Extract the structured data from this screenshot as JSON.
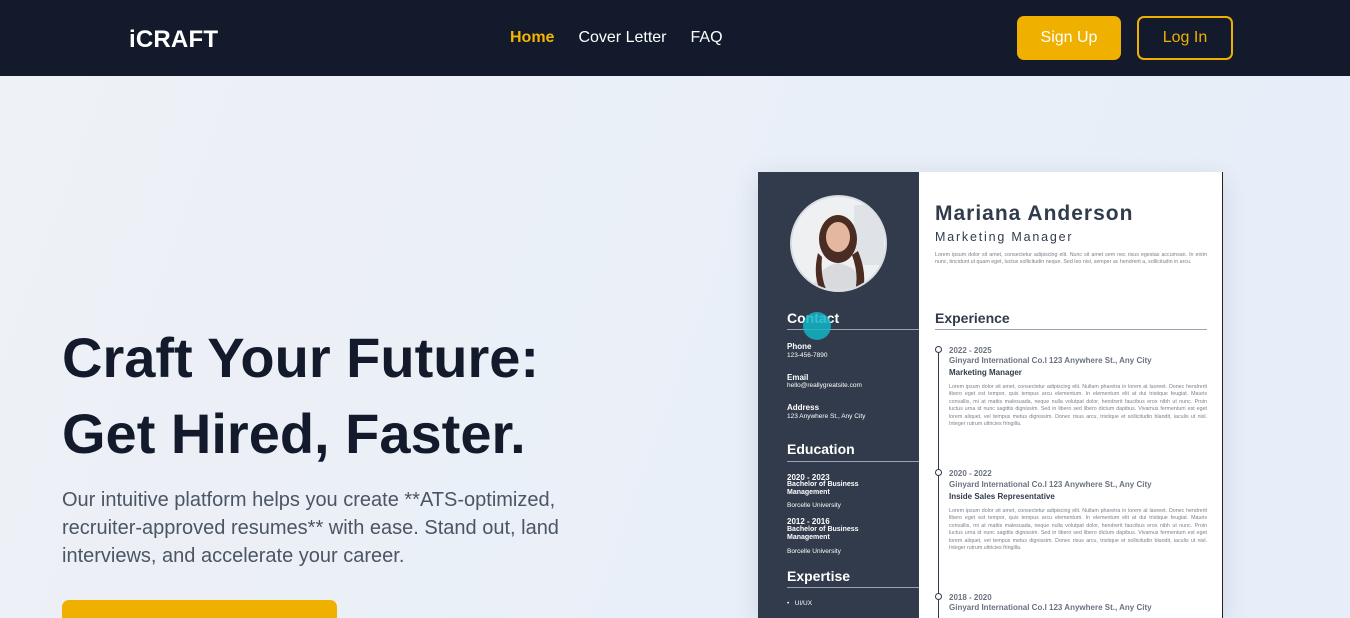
{
  "nav": {
    "brand": "iCRAFT",
    "links": [
      "Home",
      "Cover Letter",
      "FAQ"
    ],
    "signup": "Sign Up",
    "login": "Log In",
    "accent_color": "#f0b000",
    "bg_color": "#121a2c"
  },
  "hero": {
    "headline_line1": "Craft Your Future:",
    "headline_line2": "Get Hired, Faster.",
    "subtext": "Our intuitive platform helps you create **ATS-optimized, recruiter-approved resumes** with ease. Stand out, land interviews, and accelerate your career.",
    "cta_label": ""
  },
  "resume": {
    "name": "Mariana Anderson",
    "role": "Marketing Manager",
    "intro": "Lorem ipsum dolor sit amet, consectetur adipiscing elit. Nunc sit amet sem nec risus egestas accumsan. In enim nunc, tincidunt ut quam eget, luctus sollicitudin neque. Sed leo nisl, semper ac hendrerit a, sollicitudin in arcu.",
    "contact": {
      "heading": "Contact",
      "phone_label": "Phone",
      "phone": "123-456-7890",
      "email_label": "Email",
      "email": "hello@reallygreatsite.com",
      "address_label": "Address",
      "address": "123 Anywhere St., Any City"
    },
    "education": {
      "heading": "Education",
      "items": [
        {
          "period": "2020 - 2023",
          "degree_1": "Bachelor of Business",
          "degree_2": "Management",
          "school": "Borcelle University"
        },
        {
          "period": "2012 - 2016",
          "degree_1": "Bachelor of Business",
          "degree_2": "Management",
          "school": "Borcelle University"
        }
      ]
    },
    "expertise": {
      "heading": "Expertise",
      "items": [
        "UI/UX"
      ]
    },
    "experience": {
      "heading": "Experience",
      "jobs": [
        {
          "period": "2022 - 2025",
          "company": "Ginyard International Co.l 123 Anywhere St., Any City",
          "title": "Marketing Manager",
          "desc": "Lorem ipsum dolor sit amet, consectetur adipiscing elit. Nullam pharetra in lorem at laoreet. Donec hendrerit libero eget est tempor, quis tempus arcu elementum. In elementum elit at dui tristique feugiat. Mauris convallis, mi at mattis malesuada, neque nulla volutpat dolor, hendrerit faucibus eros nibh ut nunc. Proin luctus urna id nunc sagittis dignissim. Sed in libero sed libero dictum dapibus. Vivamus fermentum est eget lorem aliquet, vel tempus metus dignissim. Donec risus arcu, tristique et sollicitudin blandit, iaculis ut nisl. Integer rutrum ultricies fringilla."
        },
        {
          "period": "2020 - 2022",
          "company": "Ginyard International Co.l 123 Anywhere St., Any City",
          "title": "Inside Sales Representative",
          "desc": "Lorem ipsum dolor sit amet, consectetur adipiscing elit. Nullam pharetra in lorem at laoreet. Donec hendrerit libero eget est tempor, quis tempus arcu elementum. In elementum elit at dui tristique feugiat. Mauris convallis, mi at mattis malesuada, neque nulla volutpat dolor, hendrerit faucibus eros nibh ut nunc. Proin luctus urna id nunc sagittis dignissim. Sed in libero sed libero dictum dapibus. Vivamus fermentum est eget lorem aliquet, vel tempus metus dignissim. Donec risus arcu, tristique et sollicitudin blandit, iaculis ut nisl. Integer rutrum ultricies fringilla."
        },
        {
          "period": "2018 - 2020",
          "company": "Ginyard International Co.l 123 Anywhere St., Any City",
          "title": "",
          "desc": ""
        }
      ]
    }
  }
}
